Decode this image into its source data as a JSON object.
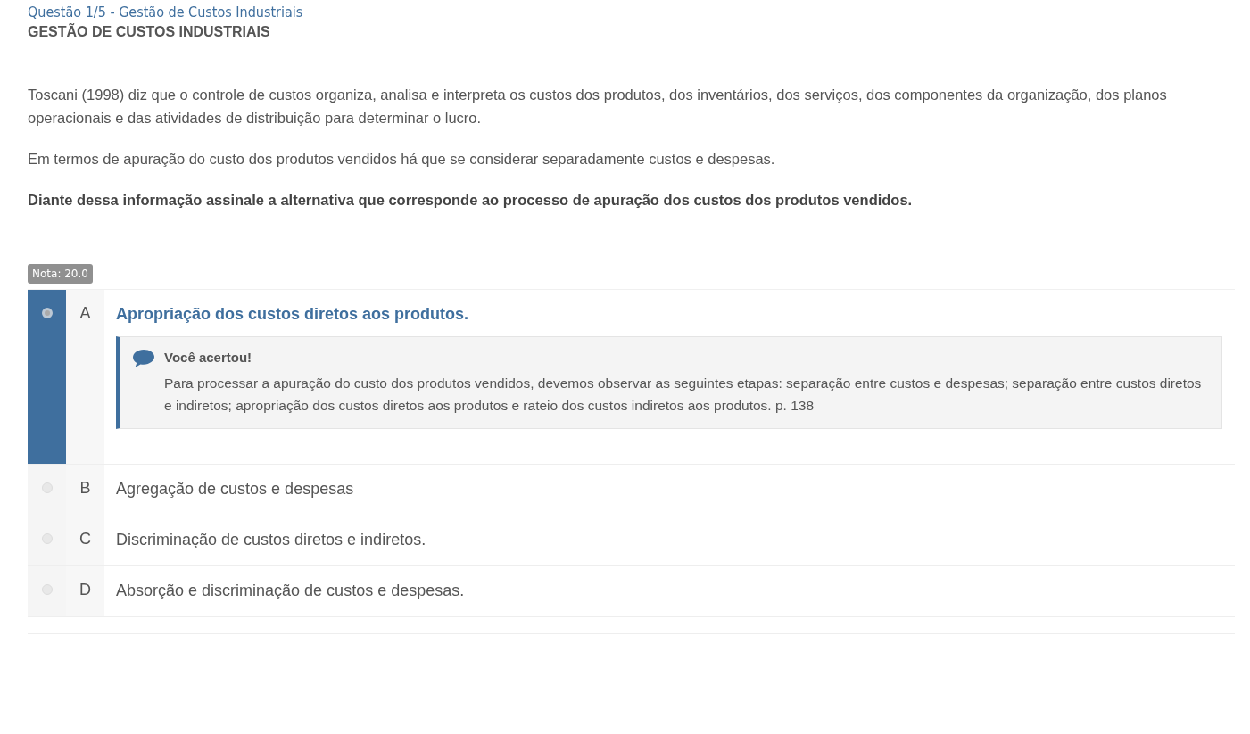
{
  "question_header": "Questão 1/5 - Gestão de Custos Industriais",
  "subject": "GESTÃO DE CUSTOS INDUSTRIAIS",
  "paragraphs": [
    {
      "kind": "text",
      "text": "Toscani (1998) diz que o controle de custos organiza, analisa e interpreta os custos dos produtos, dos inventários, dos serviços, dos componentes da organização, dos planos operacionais e das atividades de distribuição para determinar o lucro."
    },
    {
      "kind": "text",
      "text": "Em termos de apuração do custo dos produtos vendidos há que se considerar separadamente custos e despesas."
    },
    {
      "kind": "prompt",
      "text": "Diante dessa informação assinale a alternativa que corresponde ao processo de apuração dos custos dos produtos vendidos."
    }
  ],
  "grade_badge": "Nota: 20.0",
  "options": [
    {
      "letter": "A",
      "text": "Apropriação dos custos diretos aos produtos.",
      "selected": true,
      "feedback": {
        "title": "Você acertou!",
        "text": "Para processar a apuração do custo dos produtos vendidos, devemos observar as seguintes etapas: separação entre custos e despesas; separação entre custos diretos e indiretos; apropriação dos custos diretos aos produtos e rateio dos custos indiretos aos produtos. p. 138"
      }
    },
    {
      "letter": "B",
      "text": "Agregação de custos e despesas",
      "selected": false
    },
    {
      "letter": "C",
      "text": "Discriminação de custos diretos e indiretos.",
      "selected": false
    },
    {
      "letter": "D",
      "text": "Absorção e discriminação de custos e despesas.",
      "selected": false
    }
  ]
}
